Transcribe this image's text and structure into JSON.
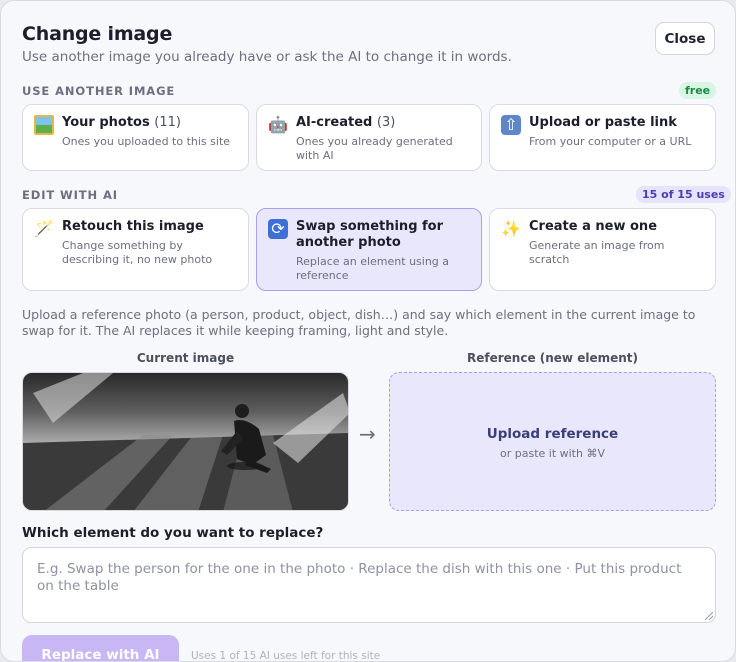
{
  "header": {
    "title": "Change image",
    "subtitle": "Use another image you already have or ask the AI to change it in words.",
    "close_label": "Close"
  },
  "use_another": {
    "label": "USE ANOTHER IMAGE",
    "badge": "free",
    "cards": [
      {
        "title": "Your photos",
        "count": "(11)",
        "desc": "Ones you uploaded to this site",
        "icon": "photo-icon"
      },
      {
        "title": "AI-created",
        "count": "(3)",
        "desc": "Ones you already generated with AI",
        "icon": "robot-icon"
      },
      {
        "title": "Upload or paste link",
        "count": "",
        "desc": "From your computer or a URL",
        "icon": "upload-icon"
      }
    ]
  },
  "edit_ai": {
    "label": "EDIT WITH AI",
    "badge": "15 of 15 uses",
    "cards": [
      {
        "title": "Retouch this image",
        "desc": "Change something by describing it, no new photo",
        "icon": "magic-wand-icon"
      },
      {
        "title": "Swap something for another photo",
        "desc": "Replace an element using a reference",
        "icon": "swap-icon",
        "selected": true
      },
      {
        "title": "Create a new one",
        "desc": "Generate an image from scratch",
        "icon": "sparkles-icon"
      }
    ]
  },
  "swap": {
    "description": "Upload a reference photo (a person, product, object, dish…) and say which element in the current image to swap for it. The AI replaces it while keeping framing, light and style.",
    "current_label": "Current image",
    "reference_label": "Reference (new element)",
    "upload_title": "Upload reference",
    "upload_hint": "or paste it with ⌘V",
    "question": "Which element do you want to replace?",
    "placeholder": "E.g. Swap the person for the one in the photo · Replace the dish with this one · Put this product on the table"
  },
  "footer": {
    "primary_label": "Replace with AI",
    "note": "Uses 1 of 15 AI uses left for this site"
  }
}
